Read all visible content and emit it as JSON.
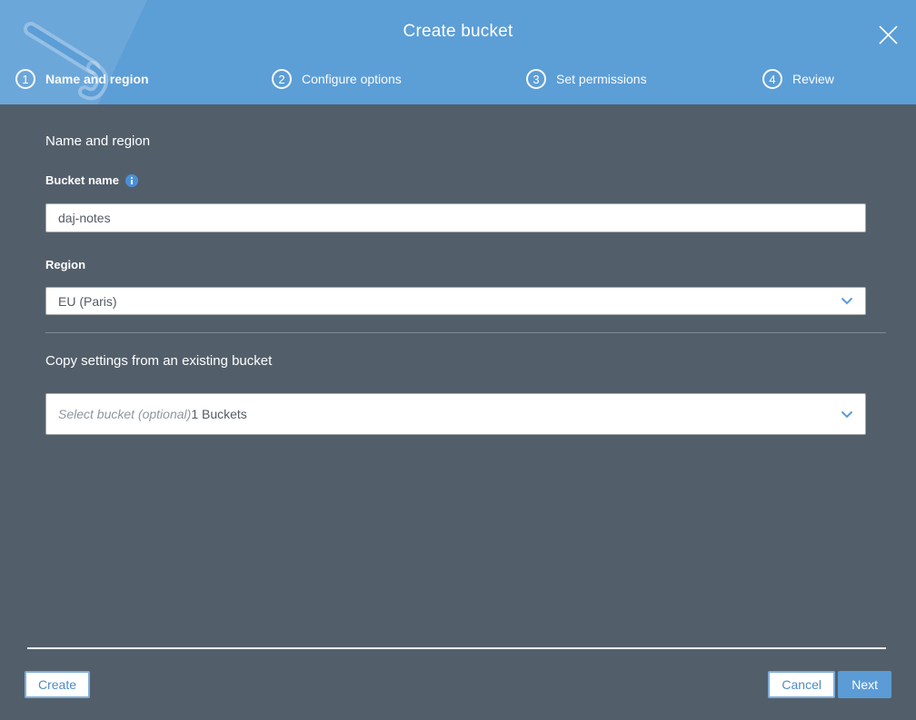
{
  "modal": {
    "title": "Create bucket"
  },
  "icons": {
    "close": "✕",
    "info": "ⓘ",
    "chevron_down": "⌄",
    "watermark": "bucket-illustration"
  },
  "steps": [
    {
      "number": "1",
      "label": "Name and region",
      "active": true
    },
    {
      "number": "2",
      "label": "Configure options",
      "active": false
    },
    {
      "number": "3",
      "label": "Set permissions",
      "active": false
    },
    {
      "number": "4",
      "label": "Review",
      "active": false
    }
  ],
  "form": {
    "section_heading": "Name and region",
    "bucket_name_label": "Bucket name",
    "bucket_name_value": "daj-notes",
    "region_label": "Region",
    "region_value": "EU (Paris)",
    "copy_settings_heading": "Copy settings from an existing bucket",
    "copy_settings_placeholder": "Select bucket (optional)",
    "copy_settings_count": "1 Buckets"
  },
  "footer": {
    "create_label": "Create",
    "cancel_label": "Cancel",
    "next_label": "Next"
  },
  "colors": {
    "header_blue": "#5C9ED6",
    "body_slate": "#525F6B",
    "accent_blue": "#4A90D9",
    "button_text_blue": "#4E8BC4"
  }
}
